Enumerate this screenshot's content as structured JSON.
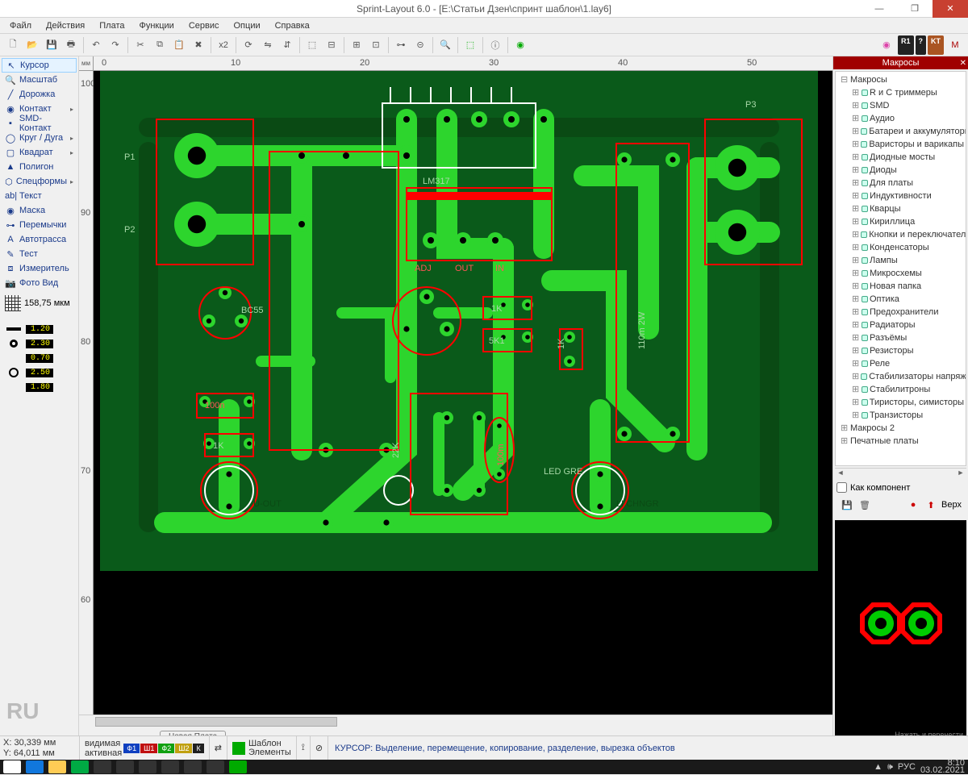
{
  "window": {
    "title": "Sprint-Layout 6.0 - [E:\\Статьи Дзен\\спринт шаблон\\1.lay6]"
  },
  "menu": [
    "Файл",
    "Действия",
    "Плата",
    "Функции",
    "Сервис",
    "Опции",
    "Справка"
  ],
  "left_tools": [
    {
      "icon": "↖",
      "label": "Курсор",
      "active": true
    },
    {
      "icon": "🔍",
      "label": "Масштаб"
    },
    {
      "icon": "╱",
      "label": "Дорожка"
    },
    {
      "icon": "◉",
      "label": "Контакт",
      "arrow": true
    },
    {
      "icon": "▪",
      "label": "SMD-Контакт"
    },
    {
      "icon": "◯",
      "label": "Круг / Дуга",
      "arrow": true
    },
    {
      "icon": "▢",
      "label": "Квадрат",
      "arrow": true
    },
    {
      "icon": "▲",
      "label": "Полигон"
    },
    {
      "icon": "⬡",
      "label": "Спецформы",
      "arrow": true
    },
    {
      "icon": "ab|",
      "label": "Текст"
    },
    {
      "icon": "◉",
      "label": "Маска"
    },
    {
      "icon": "⊶",
      "label": "Перемычки"
    },
    {
      "icon": "A",
      "label": "Автотрасса"
    },
    {
      "icon": "✎",
      "label": "Тест"
    },
    {
      "icon": "⧈",
      "label": "Измеритель"
    },
    {
      "icon": "📷",
      "label": "Фото Вид"
    }
  ],
  "grid_value": "158,75 мкм",
  "params": [
    {
      "v": "1.20"
    },
    {
      "v": "2.30"
    },
    {
      "v": "0.70"
    },
    {
      "v": "2.50"
    },
    {
      "v": "1.80"
    }
  ],
  "ru": "RU",
  "ruler_h": [
    "0",
    "10",
    "20",
    "30",
    "40",
    "50"
  ],
  "ruler_v": [
    "100",
    "90",
    "80",
    "70",
    "60"
  ],
  "tab_label": "Новая Плата",
  "pcb_labels": {
    "p1": "P1",
    "p2": "P2",
    "p3": "P3",
    "lm": "LM317",
    "adj": "ADJ",
    "out": "OUT",
    "in": "IN",
    "bc": "BC55",
    "k1": "1K",
    "k5": "5K1",
    "k1b": "1K",
    "r22": "22K",
    "n100": "100n",
    "m100": "100m",
    "uout": "U-OUT",
    "chngr": "LI CHNGR",
    "led": "LED GRE",
    "r110": "110m 2W"
  },
  "macros": {
    "header": "Макросы",
    "root": "Макросы",
    "items": [
      "R и C триммеры",
      "SMD",
      "Аудио",
      "Батареи и аккумуляторы",
      "Варисторы и варикапы",
      "Диодные мосты",
      "Диоды",
      "Для платы",
      "Индуктивности",
      "Кварцы",
      "Кириллица",
      "Кнопки и переключатели",
      "Конденсаторы",
      "Лампы",
      "Микросхемы",
      "Новая папка",
      "Оптика",
      "Предохранители",
      "Радиаторы",
      "Разъёмы",
      "Резисторы",
      "Реле",
      "Стабилизаторы напряжения",
      "Стабилитроны",
      "Тиристоры, симисторы",
      "Транзисторы"
    ],
    "root2": "Макросы 2",
    "root3": "Печатные платы",
    "chk": "Как компонент",
    "up": "Верх",
    "hint": "Нажать и перенести"
  },
  "toolbar_right": [
    "R1",
    "?",
    "KT"
  ],
  "status": {
    "x": "X:  30,339 мм",
    "y": "Y:  64,011 мм",
    "vis": "видимая",
    "act": "активная",
    "layers": [
      {
        "l": "Ф1",
        "c": "#1040c0"
      },
      {
        "l": "Ш1",
        "c": "#c01010"
      },
      {
        "l": "Ф2",
        "c": "#10a010"
      },
      {
        "l": "Ш2",
        "c": "#c0a010"
      },
      {
        "l": "К",
        "c": "#202020"
      }
    ],
    "tpl": "Шаблон",
    "elem": "Элементы",
    "msg": "КУРСОР: Выделение, перемещение, копирование, разделение, вырезка объектов"
  },
  "tray": {
    "lang": "РУС",
    "time": "8:10",
    "date": "03.02.2021"
  }
}
